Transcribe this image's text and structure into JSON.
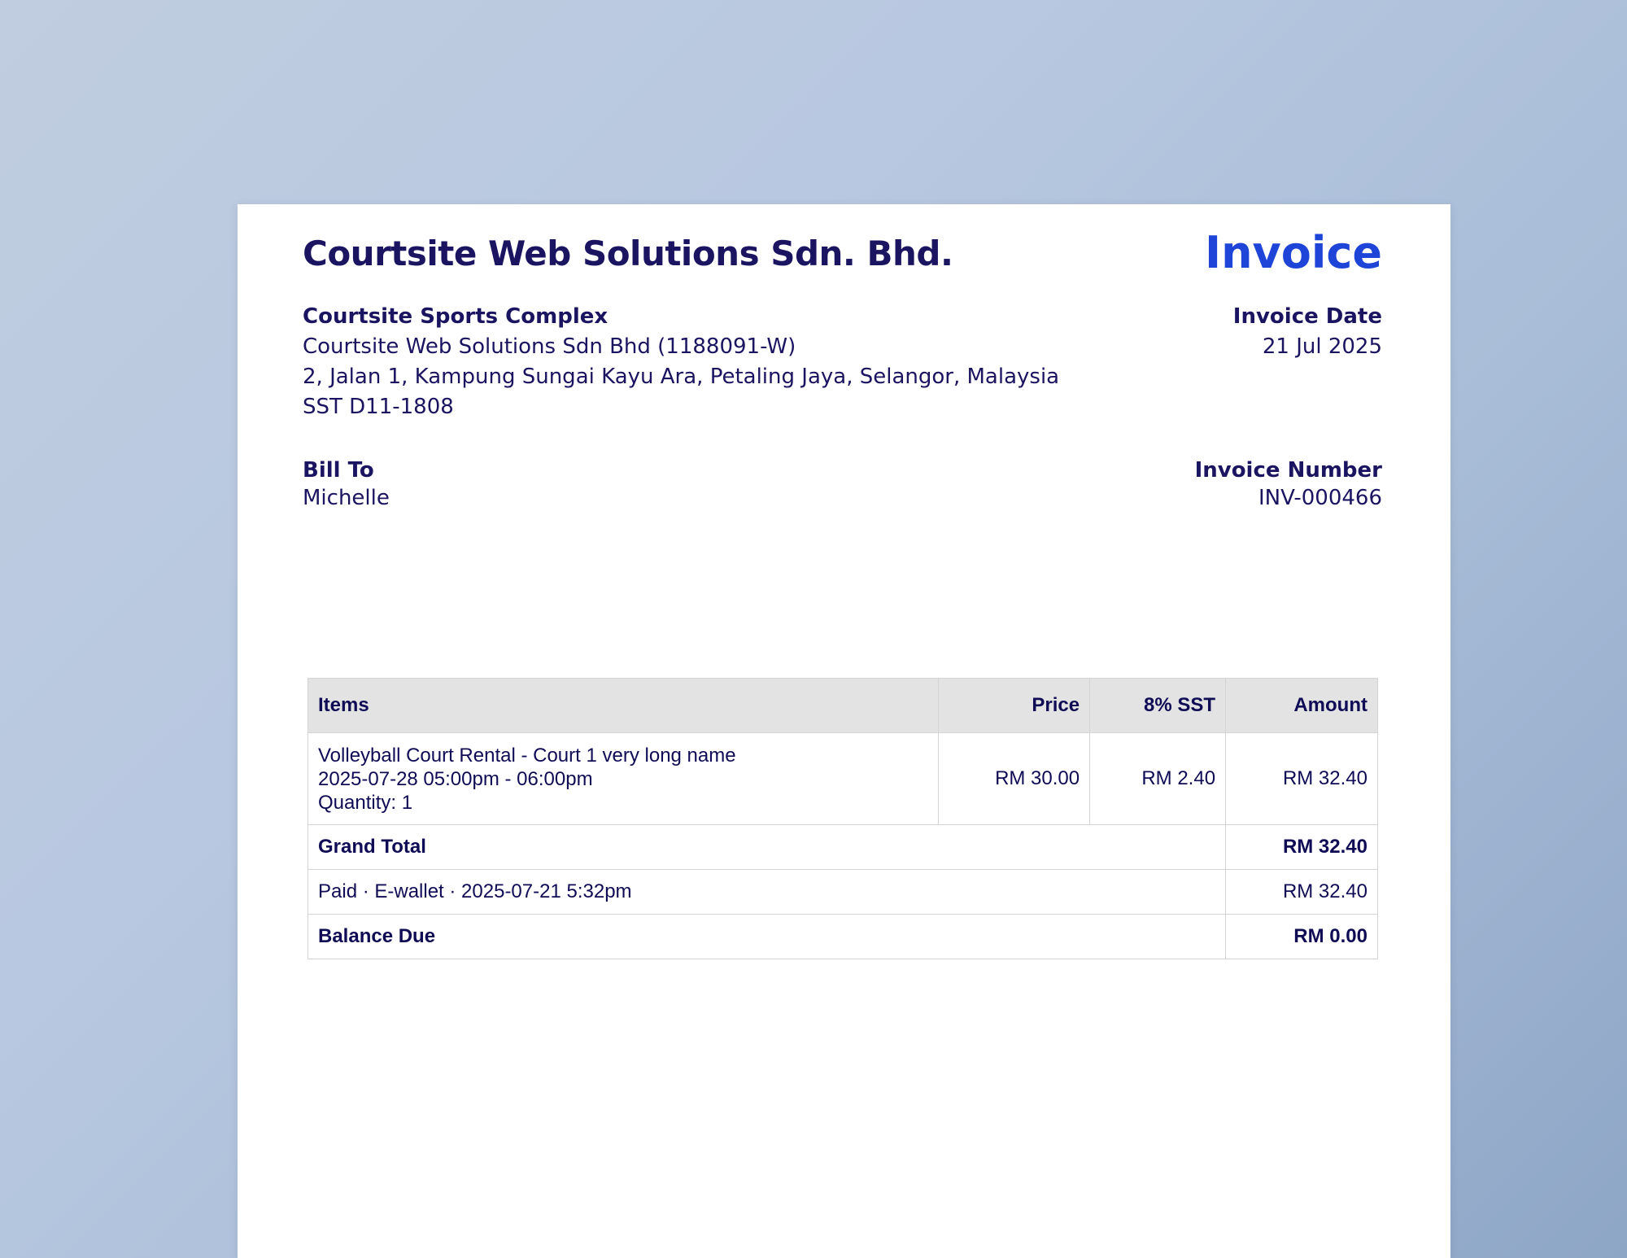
{
  "seller": {
    "company_name": "Courtsite Web Solutions Sdn. Bhd.",
    "venue_name": "Courtsite Sports Complex",
    "legal_name": "Courtsite Web Solutions Sdn Bhd (1188091-W)",
    "address": "2, Jalan 1, Kampung Sungai Kayu Ara, Petaling Jaya, Selangor, Malaysia",
    "tax_id": "SST D11-1808"
  },
  "document": {
    "title": "Invoice",
    "date_label": "Invoice Date",
    "date_value": "21 Jul 2025",
    "number_label": "Invoice Number",
    "number_value": "INV-000466"
  },
  "bill_to": {
    "label": "Bill To",
    "name": "Michelle"
  },
  "table": {
    "headers": {
      "items": "Items",
      "price": "Price",
      "tax": "8% SST",
      "amount": "Amount"
    },
    "rows": [
      {
        "name": "Volleyball Court Rental - Court 1 very long name",
        "time": "2025-07-28 05:00pm - 06:00pm",
        "quantity": "Quantity: 1",
        "price": "RM 30.00",
        "tax": "RM 2.40",
        "amount": "RM 32.40"
      }
    ],
    "grand_total": {
      "label": "Grand Total",
      "value": "RM 32.40"
    },
    "payment": {
      "label": "Paid · E-wallet · 2025-07-21 5:32pm",
      "value": "RM 32.40"
    },
    "balance_due": {
      "label": "Balance Due",
      "value": "RM 0.00"
    }
  }
}
